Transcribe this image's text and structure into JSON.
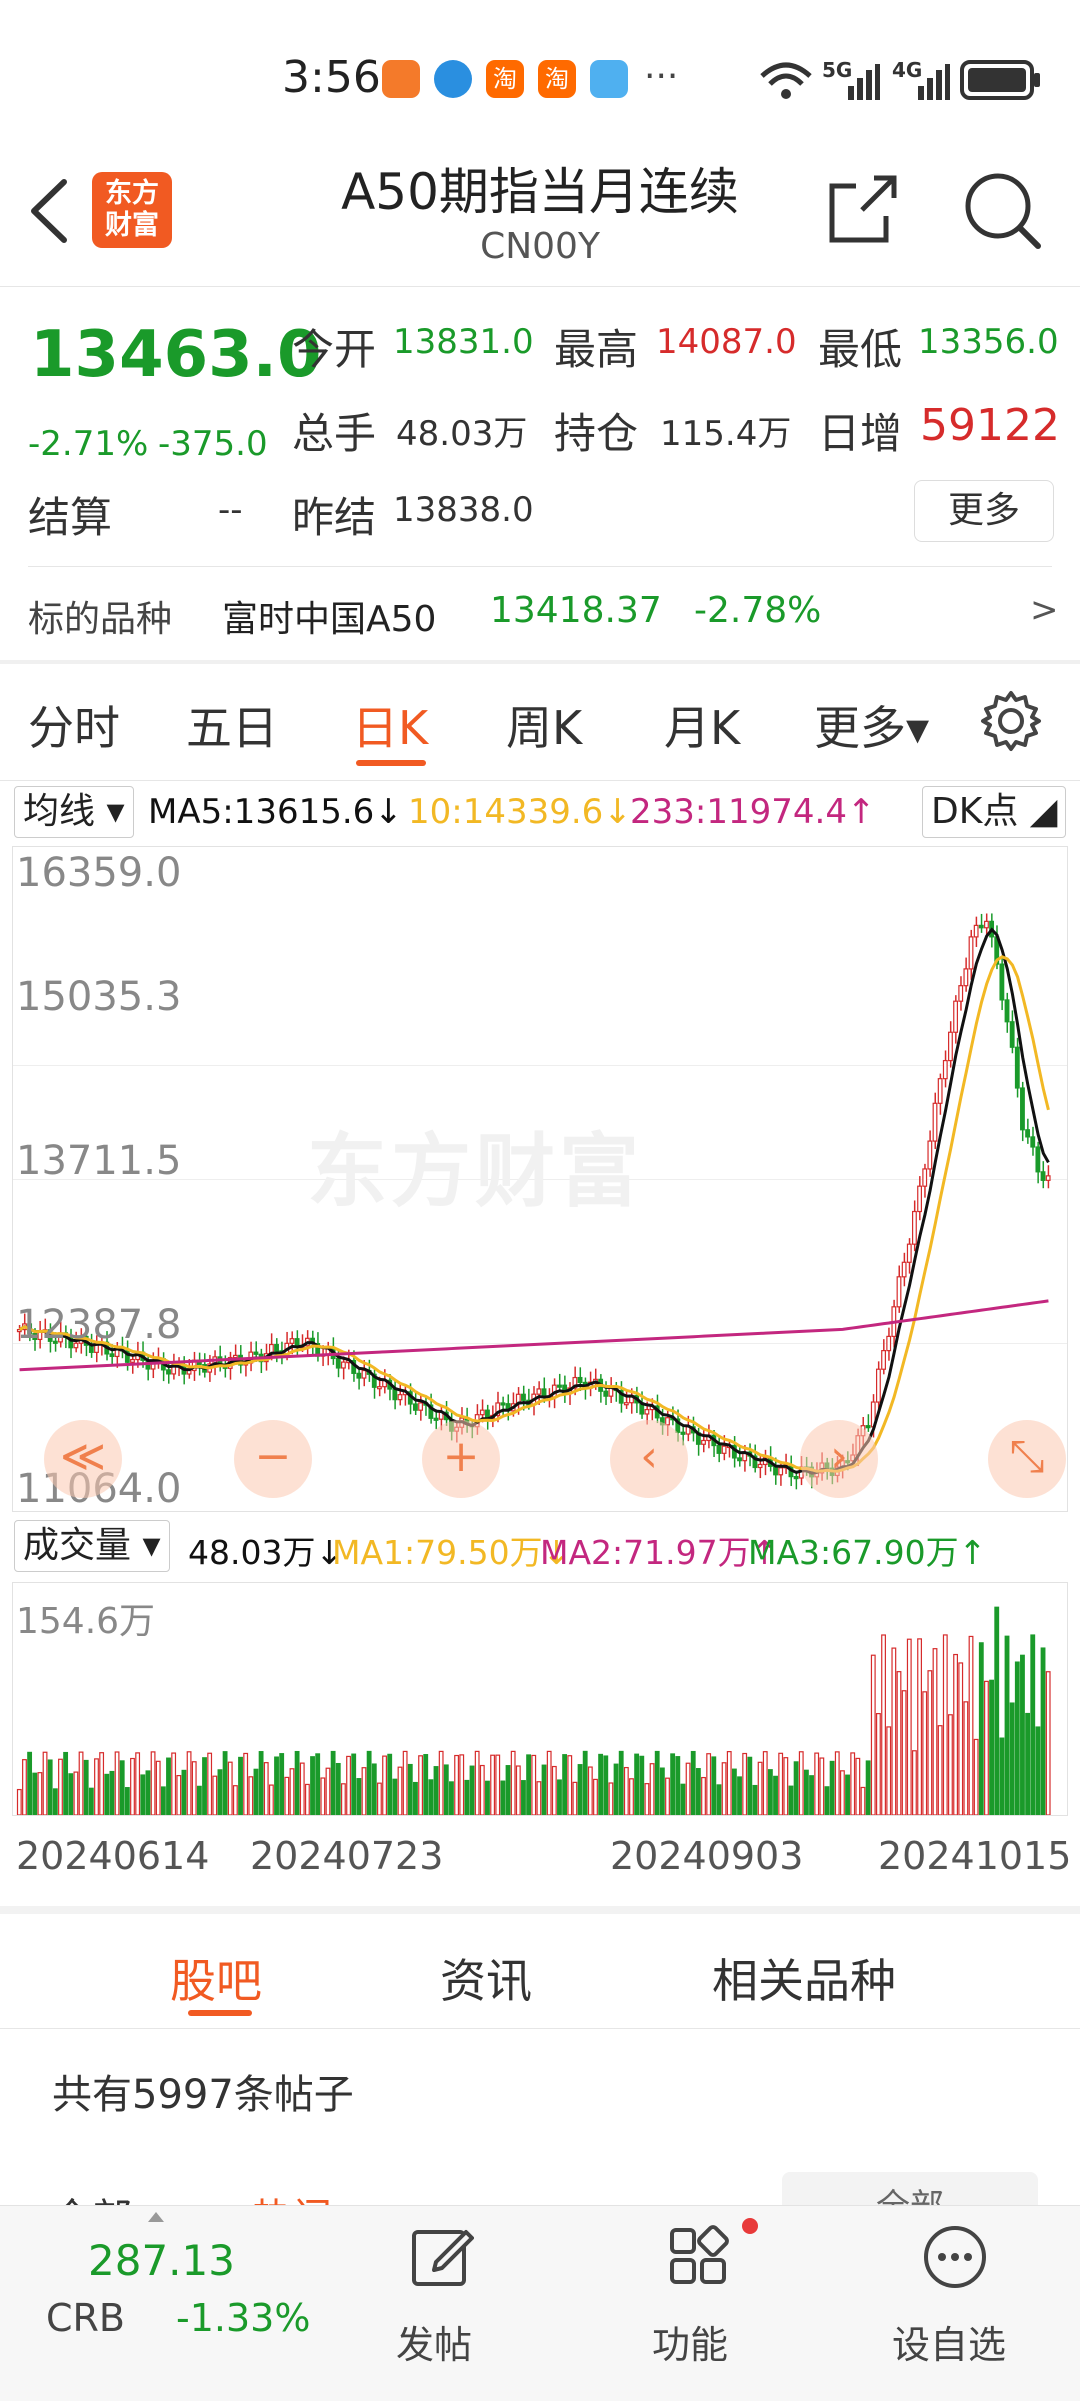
{
  "status_bar": {
    "time": "3:56",
    "more": "···",
    "net1": "5G",
    "net2": "4G"
  },
  "header": {
    "title": "A50期指当月连续",
    "code": "CN00Y",
    "logo_line1": "东方",
    "logo_line2": "财富"
  },
  "quote": {
    "price": "13463.0",
    "change_pct": "-2.71%",
    "change": "-375.0",
    "open_label": "今开",
    "open": "13831.0",
    "high_label": "最高",
    "high": "14087.0",
    "low_label": "最低",
    "low": "13356.0",
    "volume_label": "总手",
    "volume": "48.03万",
    "oi_label": "持仓",
    "oi": "115.4万",
    "daily_inc_label": "日增",
    "daily_inc": "59122",
    "settle_label": "结算",
    "settle": "--",
    "prev_settle_label": "昨结",
    "prev_settle": "13838.0",
    "more_button": "更多"
  },
  "underlying": {
    "label": "标的品种",
    "name": "富时中国A50",
    "price": "13418.37",
    "change_pct": "-2.78%",
    "arrow": ">"
  },
  "period_tabs": [
    "分时",
    "五日",
    "日K",
    "周K",
    "月K",
    "更多▾"
  ],
  "active_tab": "日K",
  "ma_bar": {
    "selector": "均线 ▾",
    "ma5": "MA5:13615.6↓",
    "ma10": "10:14339.6↓",
    "ma233": "233:11974.4↑",
    "dk": "DK点 ◢"
  },
  "price_axis": [
    "16359.0",
    "15035.3",
    "13711.5",
    "12387.8",
    "11064.0"
  ],
  "watermark": "东方财富",
  "vol_bar": {
    "selector": "成交量 ▾",
    "vol": "48.03万↓",
    "ma1": "MA1:79.50万↓",
    "ma2": "MA2:71.97万↑",
    "ma3": "MA3:67.90万↑"
  },
  "vol_axis_max": "154.6万",
  "date_axis": [
    "20240614",
    "20240723",
    "20240903",
    "20241015"
  ],
  "nav_buttons": [
    "≪",
    "−",
    "+",
    "‹",
    "›",
    "⤡"
  ],
  "bottom_tabs": [
    "股吧",
    "资讯",
    "相关品种"
  ],
  "post_count": "共有5997条帖子",
  "partial_row": {
    "left": "全部",
    "mid": "热门",
    "right": "全部"
  },
  "bottom_bar": {
    "crb_value": "287.13",
    "crb_label": "CRB",
    "crb_change": "-1.33%",
    "post_label": "发帖",
    "func_label": "功能",
    "watch_label": "设自选"
  },
  "colors": {
    "up": "#d62b2b",
    "down": "#1a9a2a",
    "accent": "#f15a22",
    "ma5": "#111111",
    "ma10": "#f2b824",
    "ma233": "#c3277f"
  },
  "chart_data": {
    "type": "candlestick",
    "y_range": [
      11064.0,
      16359.0
    ],
    "x_range": [
      "20240614",
      "20241015+"
    ],
    "overlays": [
      "MA5",
      "MA10",
      "MA233"
    ],
    "last_close": 13463.0
  }
}
